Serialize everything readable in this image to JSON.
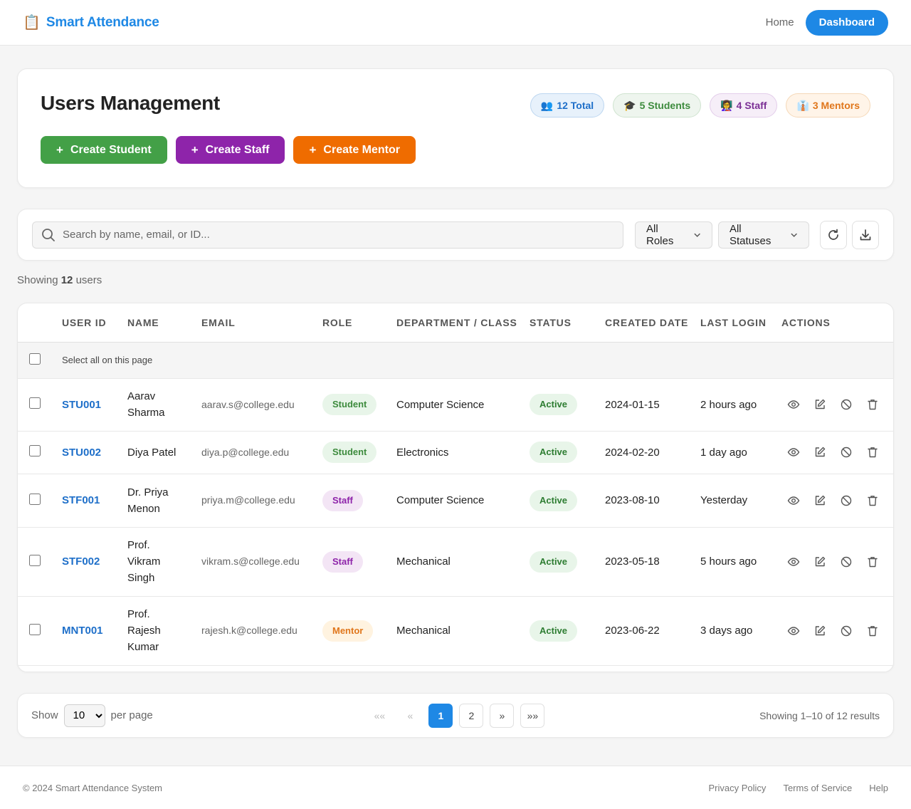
{
  "brand": {
    "icon": "📋",
    "title": "Smart Attendance"
  },
  "nav": {
    "home": "Home",
    "dashboard": "Dashboard"
  },
  "header": {
    "title": "Users Management",
    "stats": [
      {
        "icon": "👥",
        "label": "12 Total"
      },
      {
        "icon": "🎓",
        "label": "5 Students"
      },
      {
        "icon": "👩‍🏫",
        "label": "4 Staff"
      },
      {
        "icon": "👔",
        "label": "3 Mentors"
      }
    ],
    "create_buttons": {
      "plus": "+",
      "student": "Create Student",
      "staff": "Create Staff",
      "mentor": "Create Mentor"
    }
  },
  "filters": {
    "search_placeholder": "Search by name, email, or ID...",
    "role": "All Roles",
    "status": "All Statuses"
  },
  "summary": {
    "prefix": "Showing",
    "count": "12",
    "suffix": "users"
  },
  "table": {
    "columns": [
      "User ID",
      "Name",
      "Email",
      "Role",
      "Department / Class",
      "Status",
      "Created Date",
      "Last Login",
      "Actions"
    ],
    "select_all": "Select all on this page",
    "rows": [
      {
        "id": "STU001",
        "name": "Aarav Sharma",
        "email": "aarav.s@college.edu",
        "role": "Student",
        "dept": "Computer Science",
        "status": "Active",
        "created": "2024-01-15",
        "last_login": "2 hours ago"
      },
      {
        "id": "STU002",
        "name": "Diya Patel",
        "email": "diya.p@college.edu",
        "role": "Student",
        "dept": "Electronics",
        "status": "Active",
        "created": "2024-02-20",
        "last_login": "1 day ago"
      },
      {
        "id": "STF001",
        "name": "Dr. Priya Menon",
        "email": "priya.m@college.edu",
        "role": "Staff",
        "dept": "Computer Science",
        "status": "Active",
        "created": "2023-08-10",
        "last_login": "Yesterday"
      },
      {
        "id": "STF002",
        "name": "Prof. Vikram Singh",
        "email": "vikram.s@college.edu",
        "role": "Staff",
        "dept": "Mechanical",
        "status": "Active",
        "created": "2023-05-18",
        "last_login": "5 hours ago"
      },
      {
        "id": "MNT001",
        "name": "Prof. Rajesh Kumar",
        "email": "rajesh.k@college.edu",
        "role": "Mentor",
        "dept": "Mechanical",
        "status": "Active",
        "created": "2023-06-22",
        "last_login": "3 days ago"
      }
    ]
  },
  "pagination": {
    "show": "Show",
    "per_page_value": "10",
    "per_page_suffix": "per page",
    "first": "«",
    "prev": "«",
    "pages": [
      "1",
      "2"
    ],
    "current": "1",
    "next": "»",
    "last": "»»",
    "first_label": "««",
    "results": "Showing 1–10 of 12 results"
  },
  "footer": {
    "copyright": "© 2024 Smart Attendance System",
    "links": [
      "Privacy Policy",
      "Terms of Service",
      "Help"
    ]
  },
  "colors": {
    "primary": "#1e88e5",
    "student": "#43a047",
    "staff": "#8e24aa",
    "mentor": "#ef6c00"
  }
}
